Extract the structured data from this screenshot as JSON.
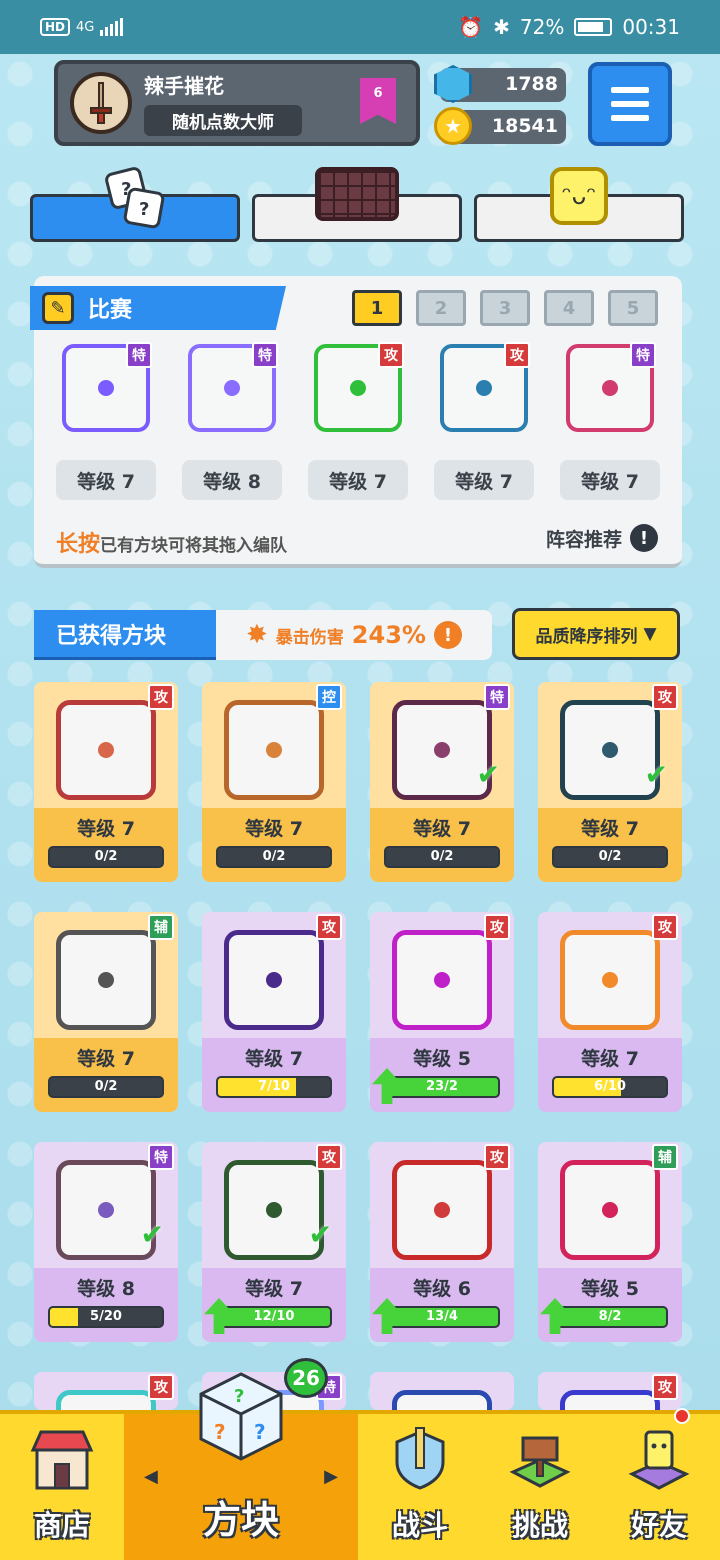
{
  "status_bar": {
    "hd": "HD",
    "network": "4G",
    "battery": "72%",
    "time": "00:31"
  },
  "profile": {
    "name": "辣手摧花",
    "title": "随机点数大师",
    "rank": "6"
  },
  "currency": {
    "gems": "1788",
    "coins": "18541"
  },
  "competition": {
    "title": "比赛",
    "pages": [
      "1",
      "2",
      "3",
      "4",
      "5"
    ],
    "active_page": 1,
    "team": [
      {
        "tag": "特",
        "tag_type": "special",
        "level": "等级 7",
        "color": "#7b5cff"
      },
      {
        "tag": "特",
        "tag_type": "special",
        "level": "等级 8",
        "color": "#8a6cff"
      },
      {
        "tag": "攻",
        "tag_type": "attack",
        "level": "等级 7",
        "color": "#2fbf3a"
      },
      {
        "tag": "攻",
        "tag_type": "attack",
        "level": "等级 7",
        "color": "#2a7fb0"
      },
      {
        "tag": "特",
        "tag_type": "special",
        "level": "等级 7",
        "color": "#d23b6d"
      }
    ],
    "hint_highlight": "长按",
    "hint_rest": "已有方块可将其拖入编队",
    "recommend": "阵容推荐"
  },
  "owned": {
    "title": "已获得方块",
    "crit_label": "暴击伤害",
    "crit_value": "243%",
    "sort": "品质降序排列"
  },
  "owned_cards": [
    {
      "tier": "legend",
      "tag": "攻",
      "tag_type": "attack",
      "level": "等级 7",
      "progress": "0/2",
      "fill": 0,
      "fill_color": "yellow",
      "upgrade": false,
      "checked": false,
      "color": "#d8664a",
      "frame": "#b83a3a"
    },
    {
      "tier": "legend",
      "tag": "控",
      "tag_type": "control",
      "level": "等级 7",
      "progress": "0/2",
      "fill": 0,
      "fill_color": "yellow",
      "upgrade": false,
      "checked": false,
      "color": "#d8823a",
      "frame": "#b8662a"
    },
    {
      "tier": "legend",
      "tag": "特",
      "tag_type": "special",
      "level": "等级 7",
      "progress": "0/2",
      "fill": 0,
      "fill_color": "yellow",
      "upgrade": false,
      "checked": true,
      "color": "#8a3f6d",
      "frame": "#5c2a48"
    },
    {
      "tier": "legend",
      "tag": "攻",
      "tag_type": "attack",
      "level": "等级 7",
      "progress": "0/2",
      "fill": 0,
      "fill_color": "yellow",
      "upgrade": false,
      "checked": true,
      "color": "#2f5a6d",
      "frame": "#234250"
    },
    {
      "tier": "legend",
      "tag": "辅",
      "tag_type": "support",
      "level": "等级 7",
      "progress": "0/2",
      "fill": 0,
      "fill_color": "yellow",
      "upgrade": false,
      "checked": false,
      "color": "#555555",
      "frame": "#555555"
    },
    {
      "tier": "epic",
      "tag": "攻",
      "tag_type": "attack",
      "level": "等级 7",
      "progress": "7/10",
      "fill": 0.7,
      "fill_color": "yellow",
      "upgrade": false,
      "checked": false,
      "color": "#4a2a8a",
      "frame": "#4a2a8a"
    },
    {
      "tier": "epic",
      "tag": "攻",
      "tag_type": "attack",
      "level": "等级 5",
      "progress": "23/2",
      "fill": 1,
      "fill_color": "green",
      "upgrade": true,
      "checked": false,
      "color": "#c020c8",
      "frame": "#c020c8"
    },
    {
      "tier": "epic",
      "tag": "攻",
      "tag_type": "attack",
      "level": "等级 7",
      "progress": "6/10",
      "fill": 0.6,
      "fill_color": "yellow",
      "upgrade": false,
      "checked": false,
      "color": "#f08a2a",
      "frame": "#f08a2a"
    },
    {
      "tier": "epic",
      "tag": "特",
      "tag_type": "special",
      "level": "等级 8",
      "progress": "5/20",
      "fill": 0.25,
      "fill_color": "yellow",
      "upgrade": false,
      "checked": true,
      "color": "#7a5cbf",
      "frame": "#6a4a5a"
    },
    {
      "tier": "epic",
      "tag": "攻",
      "tag_type": "attack",
      "level": "等级 7",
      "progress": "12/10",
      "fill": 1,
      "fill_color": "green",
      "upgrade": true,
      "checked": true,
      "color": "#2f5a2f",
      "frame": "#2f5a2f"
    },
    {
      "tier": "epic",
      "tag": "攻",
      "tag_type": "attack",
      "level": "等级 6",
      "progress": "13/4",
      "fill": 1,
      "fill_color": "green",
      "upgrade": true,
      "checked": false,
      "color": "#d23b3b",
      "frame": "#c82a2a"
    },
    {
      "tier": "epic",
      "tag": "辅",
      "tag_type": "support",
      "level": "等级 5",
      "progress": "8/2",
      "fill": 1,
      "fill_color": "green",
      "upgrade": true,
      "checked": false,
      "color": "#d2245b",
      "frame": "#d2245b"
    }
  ],
  "partial_row_tags": [
    {
      "tag": "攻",
      "tag_type": "attack"
    },
    {
      "tag": "特",
      "tag_type": "special"
    },
    {
      "tag": "攻",
      "tag_type": "attack"
    }
  ],
  "nav": {
    "shop": "商店",
    "dice": "方块",
    "battle": "战斗",
    "challenge": "挑战",
    "friends": "好友",
    "badge": "26",
    "prev_arrow": "◀",
    "next_arrow": "▶"
  },
  "colors": {
    "accent_blue": "#2d8ef0",
    "yellow": "#ffd92e",
    "orange": "#f07f26"
  }
}
